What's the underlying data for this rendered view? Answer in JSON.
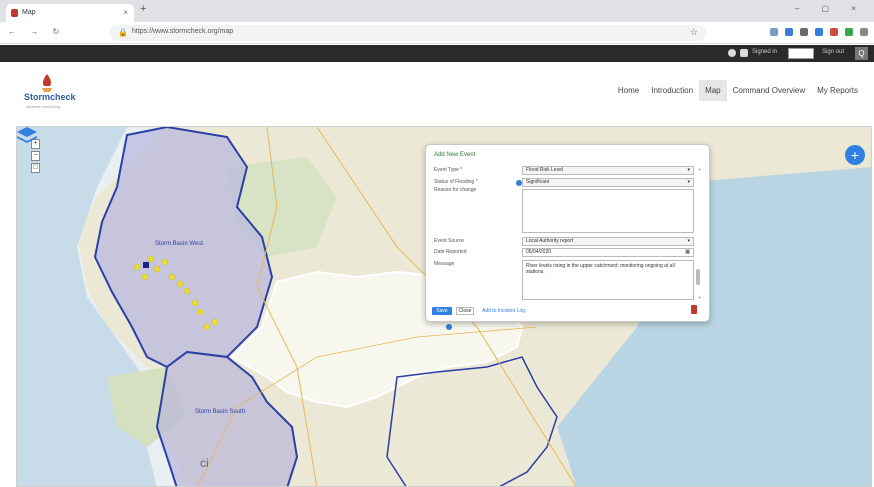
{
  "browser": {
    "tab_title": "Map",
    "tab_close": "×",
    "new_tab": "+",
    "window_controls": "– ▢ ×",
    "nav_buttons": "← → ↻",
    "url": "https://www.stormcheck.org/map",
    "lock_icon": "lock-icon",
    "star_icon": "star-icon"
  },
  "topbar": {
    "user_label": "Signed in",
    "sign_out": "Sign out",
    "search_button": "Q"
  },
  "site": {
    "logo_text": "Stormcheck",
    "logo_tagline": "weather monitoring",
    "nav": [
      {
        "label": "Home",
        "active": false
      },
      {
        "label": "Introduction",
        "active": false
      },
      {
        "label": "Map",
        "active": true
      },
      {
        "label": "Command Overview",
        "active": false
      },
      {
        "label": "My Reports",
        "active": false
      }
    ]
  },
  "map": {
    "zoom_in": "+",
    "zoom_out": "−",
    "zoom_other": "□",
    "add_button": "+",
    "region_labels": [
      "Storm Basin West",
      "Storm Basin South"
    ]
  },
  "popup": {
    "title": "Add New Event",
    "fields": [
      {
        "label": "Event Type *",
        "value": "Flood Risk Level"
      },
      {
        "label": "Status of Flooding *",
        "value": "Significant"
      },
      {
        "label": "Reason for change",
        "value": ""
      },
      {
        "label": "Event Source",
        "value": "Local Authority report"
      },
      {
        "label": "Date Reported",
        "value": "05/04/2020"
      },
      {
        "label": "Message",
        "value": "River levels rising in the upper catchment; monitoring ongoing at all stations."
      }
    ],
    "save": "Save",
    "close": "Close",
    "link": "Add to Incident Log",
    "side_a": "+",
    "side_b": "+"
  },
  "footer_fragment": "ci",
  "colors": {
    "accent": "#2f80e0",
    "region_border": "#2b3fa6",
    "highlight_fill": "#f7f7ee",
    "marker": "#e8dc3a"
  }
}
